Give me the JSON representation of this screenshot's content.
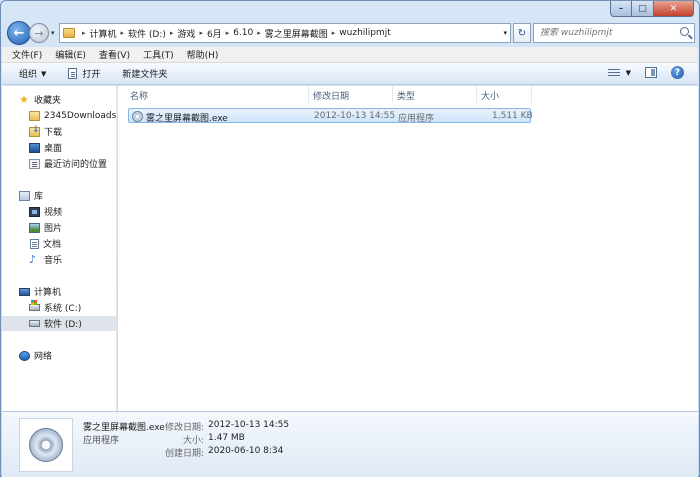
{
  "address": {
    "crumbs": [
      "计算机",
      "软件 (D:)",
      "游戏",
      "6月",
      "6.10",
      "雾之里屏幕截图",
      "wuzhilipmjt"
    ]
  },
  "search": {
    "placeholder": "搜索 wuzhilipmjt"
  },
  "menu": [
    "文件(F)",
    "编辑(E)",
    "查看(V)",
    "工具(T)",
    "帮助(H)"
  ],
  "toolbar": {
    "organize": "组织",
    "open": "打开",
    "new_folder": "新建文件夹"
  },
  "nav": {
    "favorites": "收藏夹",
    "fav_items": [
      "2345Downloads",
      "下载",
      "桌面",
      "最近访问的位置"
    ],
    "libraries": "库",
    "lib_items": [
      "视频",
      "图片",
      "文档",
      "音乐"
    ],
    "computer": "计算机",
    "drives": [
      "系统 (C:)",
      "软件 (D:)"
    ],
    "network": "网络"
  },
  "columns": {
    "name": "名称",
    "modified": "修改日期",
    "type": "类型",
    "size": "大小"
  },
  "files": [
    {
      "name": "雾之里屏幕截图.exe",
      "modified": "2012-10-13 14:55",
      "type": "应用程序",
      "size": "1,511 KB"
    }
  ],
  "details": {
    "name": "雾之里屏幕截图.exe",
    "type": "应用程序",
    "modified_label": "修改日期:",
    "modified": "2012-10-13 14:55",
    "size_label": "大小:",
    "size": "1.47 MB",
    "created_label": "创建日期:",
    "created": "2020-06-10 8:34"
  },
  "colors": {
    "selection": "#cde4fa",
    "selection_border": "#86b6e8",
    "accent": "#1f5fb3"
  }
}
